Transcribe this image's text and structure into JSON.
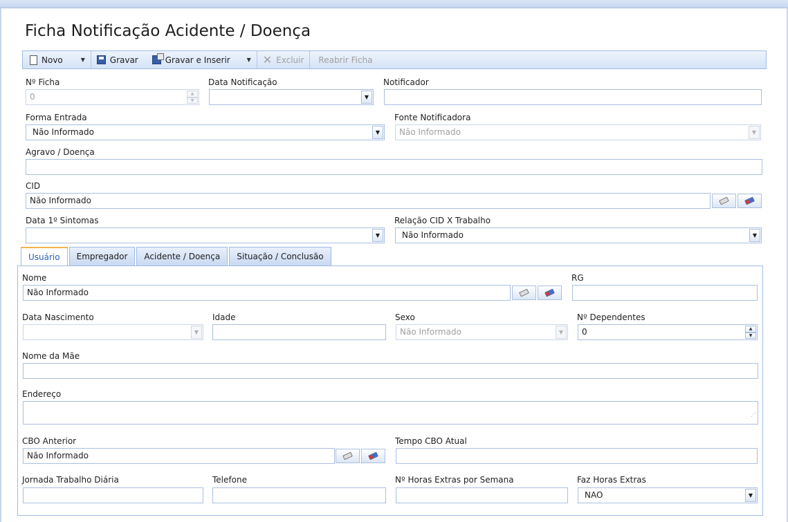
{
  "form": {
    "title": "Ficha Notificação Acidente / Doença"
  },
  "toolbar": {
    "novo": "Novo",
    "gravar": "Gravar",
    "gravar_inserir": "Gravar e Inserir",
    "excluir": "Excluir",
    "reabrir": "Reabrir Ficha"
  },
  "fields": {
    "n_ficha": {
      "label": "Nº Ficha",
      "value": "0"
    },
    "data_notificacao": {
      "label": "Data Notificação",
      "value": ""
    },
    "notificador": {
      "label": "Notificador",
      "value": ""
    },
    "forma_entrada": {
      "label": "Forma Entrada",
      "value": "Não Informado"
    },
    "fonte_notificadora": {
      "label": "Fonte Notificadora",
      "value": "Não Informado"
    },
    "agravo": {
      "label": "Agravo / Doença",
      "value": ""
    },
    "cid": {
      "label": "CID",
      "value": "Não Informado"
    },
    "data_sintomas": {
      "label": "Data 1º Sintomas",
      "value": ""
    },
    "relacao_cid": {
      "label": "Relação CID X Trabalho",
      "value": "Não Informado"
    }
  },
  "tabs": [
    {
      "label": "Usuário"
    },
    {
      "label": "Empregador"
    },
    {
      "label": "Acidente / Doença"
    },
    {
      "label": "Situação / Conclusão"
    }
  ],
  "usuario": {
    "nome": {
      "label": "Nome",
      "value": "Não Informado"
    },
    "rg": {
      "label": "RG",
      "value": ""
    },
    "data_nascimento": {
      "label": "Data Nascimento",
      "value": ""
    },
    "idade": {
      "label": "Idade",
      "value": ""
    },
    "sexo": {
      "label": "Sexo",
      "value": "Não Informado"
    },
    "n_dependentes": {
      "label": "Nº Dependentes",
      "value": "0"
    },
    "nome_mae": {
      "label": "Nome da Mãe",
      "value": ""
    },
    "endereco": {
      "label": "Endereço",
      "value": ""
    },
    "cbo_anterior": {
      "label": "CBO Anterior",
      "value": "Não Informado"
    },
    "tempo_cbo": {
      "label": "Tempo CBO Atual",
      "value": ""
    },
    "jornada": {
      "label": "Jornada Trabalho Diária",
      "value": ""
    },
    "telefone": {
      "label": "Telefone",
      "value": ""
    },
    "horas_extras_semana": {
      "label": "Nº Horas Extras por Semana",
      "value": ""
    },
    "faz_horas_extras": {
      "label": "Faz Horas Extras",
      "value": "NAO"
    }
  },
  "colors": {
    "accent": "#f0b449",
    "border": "#a9bfe0",
    "toolbar_bg": "#d4e2f6",
    "active_tab_text": "#2a5db0"
  },
  "icons": {
    "novo": "new-document-icon",
    "gravar": "save-icon",
    "gravar_inserir": "save-insert-icon",
    "excluir": "delete-x-icon",
    "clear": "eraser-icon",
    "search": "color-eraser-icon"
  }
}
